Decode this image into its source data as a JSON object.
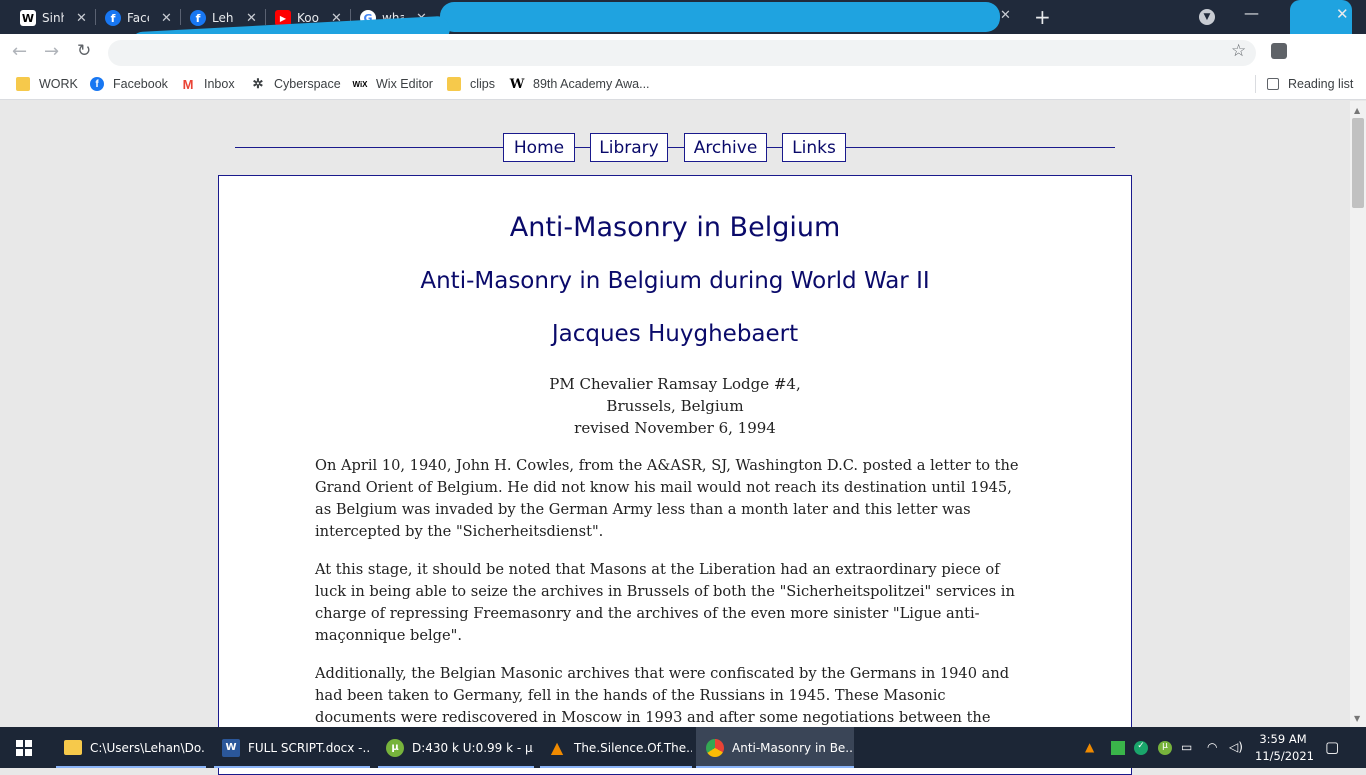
{
  "browser": {
    "tabs": [
      {
        "title": "Sinh",
        "icon": "wikipedia-icon"
      },
      {
        "title": "Face",
        "icon": "facebook-icon"
      },
      {
        "title": "Leha",
        "icon": "facebook-icon"
      },
      {
        "title": "Koo",
        "icon": "youtube-icon"
      },
      {
        "title": "wha",
        "icon": "google-icon"
      }
    ],
    "new_tab_label": "+",
    "bookmarks": [
      {
        "label": "WORK",
        "icon": "folder-icon"
      },
      {
        "label": "Facebook",
        "icon": "facebook-icon"
      },
      {
        "label": "Inbox",
        "icon": "gmail-icon"
      },
      {
        "label": "Cyberspace",
        "icon": "gear-icon"
      },
      {
        "label": "Wix Editor",
        "icon": "wix-icon"
      },
      {
        "label": "clips",
        "icon": "folder-icon"
      },
      {
        "label": "89th Academy Awa...",
        "icon": "wikipedia-icon"
      }
    ],
    "reading_list": "Reading list"
  },
  "site": {
    "nav": [
      "Home",
      "Library",
      "Archive",
      "Links"
    ],
    "title": "Anti-Masonry in Belgium",
    "subtitle": "Anti-Masonry in Belgium during World War II",
    "author": "Jacques Huyghebaert",
    "address_lines": [
      "PM Chevalier Ramsay Lodge #4,",
      "Brussels, Belgium",
      "revised November 6, 1994"
    ],
    "paragraphs": [
      [
        "On April 10, 1940, John H. Cowles, from the A&ASR, SJ, Washington D.C. posted a letter to the",
        "Grand Orient of Belgium. He did not know his mail would not reach its destination until 1945,",
        "as Belgium was invaded by the German Army less than a month later and this letter was",
        "intercepted by the \"Sicherheitsdienst\"."
      ],
      [
        "At this stage, it should be noted that Masons at the Liberation had an extraordinary piece of",
        "luck in being able to seize the archives in Brussels of both the \"Sicherheitspolitzei\" services in",
        "charge of repressing Freemasonry and the archives of the even more sinister \"Ligue anti-",
        "maçonnique belge\"."
      ],
      [
        "Additionally, the Belgian Masonic archives that were confiscated by the Germans in 1940 and",
        "had been taken to Germany, fell in the hands of the Russians in 1945. These Masonic",
        "documents were rediscovered in Moscow in 1993 and after some negotiations between the"
      ]
    ]
  },
  "taskbar": {
    "apps": [
      {
        "label": "C:\\Users\\Lehan\\Do...",
        "icon": "folder-icon"
      },
      {
        "label": "FULL SCRIPT.docx -...",
        "icon": "word-icon"
      },
      {
        "label": "D:430 k U:0.99 k - µ...",
        "icon": "utorrent-icon"
      },
      {
        "label": "The.Silence.Of.The....",
        "icon": "vlc-icon"
      },
      {
        "label": "Anti-Masonry in Be...",
        "icon": "chrome-icon"
      }
    ],
    "time": "3:59 AM",
    "date": "11/5/2021"
  }
}
